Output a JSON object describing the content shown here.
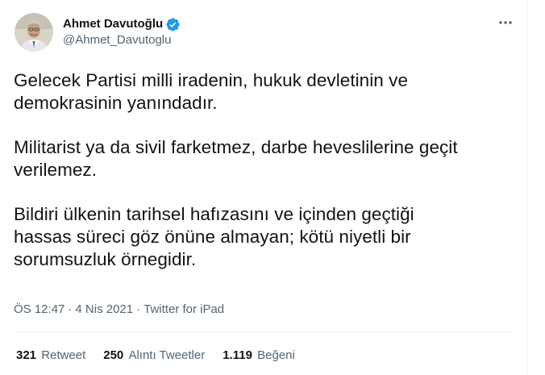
{
  "author": {
    "name": "Ahmet Davutoğlu",
    "handle": "@Ahmet_Davutoglu",
    "verified": true,
    "avatar_icon": "profile-photo-avatar"
  },
  "tweet": {
    "paragraphs": [
      [
        "Gelecek Partisi milli iradenin, hukuk devletinin ve",
        "demokrasinin yanındadır."
      ],
      [
        "Militarist ya da sivil farketmez, darbe heveslilerine geçit",
        "verilemez."
      ],
      [
        "Bildiri ülkenin tarihsel hafızasını ve içinden geçtiği",
        "hassas süreci göz önüne almayan; kötü niyetli bir",
        "sorumsuzluk örnegidir."
      ]
    ]
  },
  "meta": {
    "time": "ÖS 12:47",
    "date": "4 Nis 2021",
    "source": "Twitter for iPad",
    "separator": "·"
  },
  "stats": {
    "retweets_count": "321",
    "retweets_label": "Retweet",
    "quotes_count": "250",
    "quotes_label": "Alıntı Tweetler",
    "likes_count": "1.119",
    "likes_label": "Beğeni"
  },
  "colors": {
    "text": "#0f1419",
    "secondary": "#536471",
    "verified": "#1d9bf0",
    "divider": "#eff3f4"
  }
}
